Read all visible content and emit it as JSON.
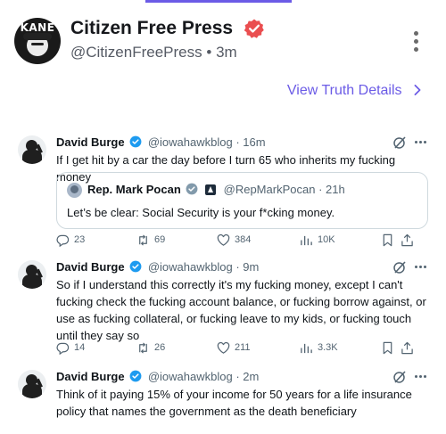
{
  "header": {
    "account_name": "Citizen Free Press",
    "account_handle": "@CitizenFreePress",
    "post_age": "3m",
    "avatar_text": "KANE",
    "view_details_label": "View Truth Details"
  },
  "colors": {
    "accent": "#6b5be6",
    "verified_red": "#ea4e50",
    "verified_blue": "#1d9bf0",
    "muted": "#536471"
  },
  "icons": {
    "verified": "verified-badge-icon",
    "grok": "grok-icon",
    "reply": "reply-icon",
    "repost": "repost-icon",
    "like": "heart-icon",
    "views": "bar-chart-icon",
    "bookmark": "bookmark-icon",
    "share": "share-icon"
  },
  "tweets": [
    {
      "name": "David Burge",
      "handle": "@iowahawkblog",
      "time": "16m",
      "text": "If I get hit by a car the day before I turn 65 who inherits my fucking money",
      "quote": {
        "name": "Rep. Mark Pocan",
        "handle": "@RepMarkPocan",
        "time": "21h",
        "text": "Let’s be clear: Social Security is your f*cking money."
      },
      "stats": {
        "replies": "23",
        "reposts": "69",
        "likes": "384",
        "views": "10K"
      }
    },
    {
      "name": "David Burge",
      "handle": "@iowahawkblog",
      "time": "9m",
      "text": "So if I understand this correctly it's my fucking money, except I can't fucking check the fucking account balance, or fucking borrow against, or use as fucking collateral, or fucking leave to my kids, or fucking touch until they say so",
      "stats": {
        "replies": "14",
        "reposts": "26",
        "likes": "211",
        "views": "3.3K"
      }
    },
    {
      "name": "David Burge",
      "handle": "@iowahawkblog",
      "time": "2m",
      "text": "Think of it paying 15% of your income for 50 years for a life insurance policy that names the government as the death beneficiary"
    }
  ]
}
